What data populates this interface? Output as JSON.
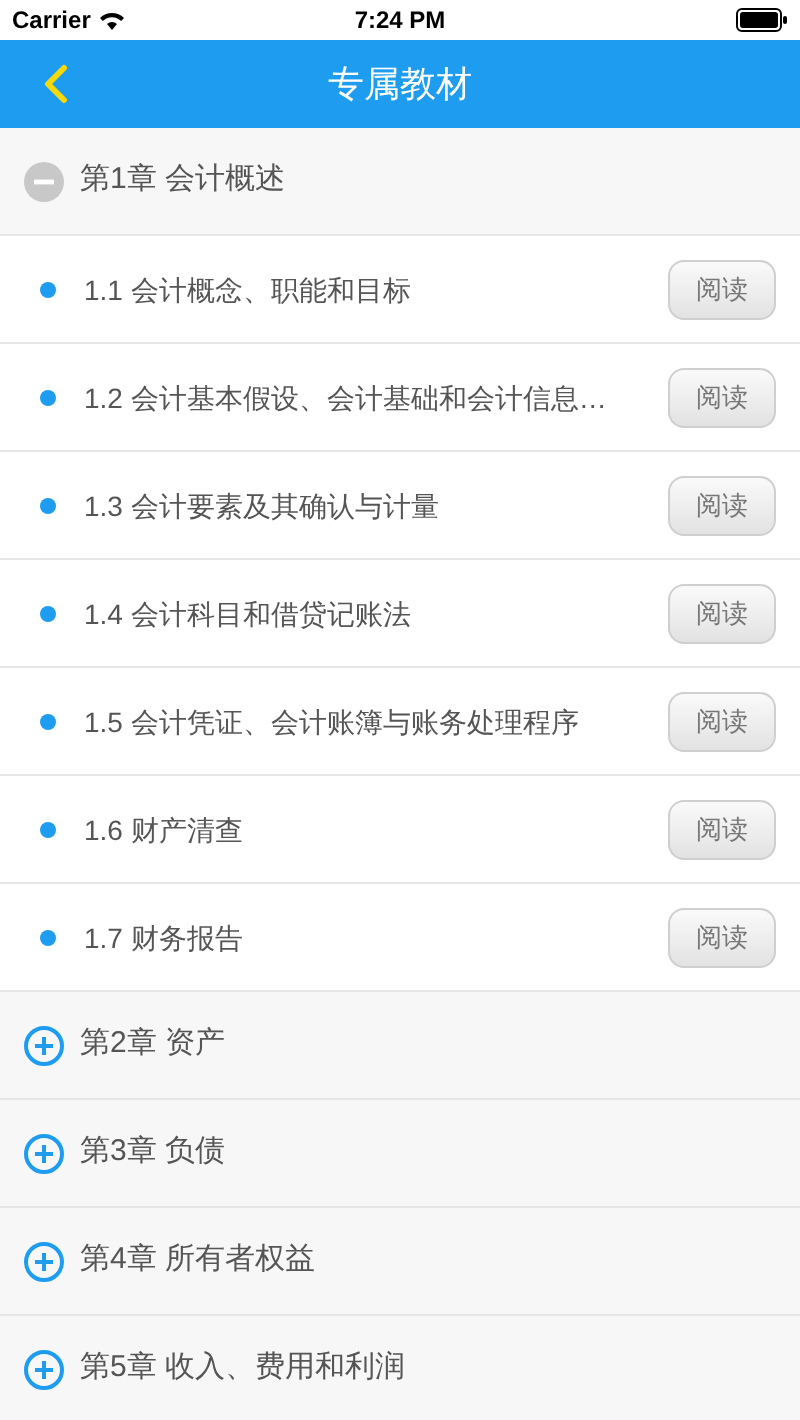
{
  "status_bar": {
    "carrier": "Carrier",
    "time": "7:24 PM"
  },
  "nav": {
    "title": "专属教材"
  },
  "chapters": [
    {
      "title": "第1章 会计概述",
      "expanded": true,
      "sections": [
        {
          "title": "1.1 会计概念、职能和目标",
          "button": "阅读"
        },
        {
          "title": "1.2 会计基本假设、会计基础和会计信息…",
          "button": "阅读"
        },
        {
          "title": "1.3 会计要素及其确认与计量",
          "button": "阅读"
        },
        {
          "title": "1.4 会计科目和借贷记账法",
          "button": "阅读"
        },
        {
          "title": "1.5 会计凭证、会计账簿与账务处理程序",
          "button": "阅读"
        },
        {
          "title": "1.6 财产清查",
          "button": "阅读"
        },
        {
          "title": "1.7 财务报告",
          "button": "阅读"
        }
      ]
    },
    {
      "title": "第2章 资产",
      "expanded": false
    },
    {
      "title": "第3章 负债",
      "expanded": false
    },
    {
      "title": "第4章 所有者权益",
      "expanded": false
    },
    {
      "title": "第5章 收入、费用和利润",
      "expanded": false
    }
  ]
}
